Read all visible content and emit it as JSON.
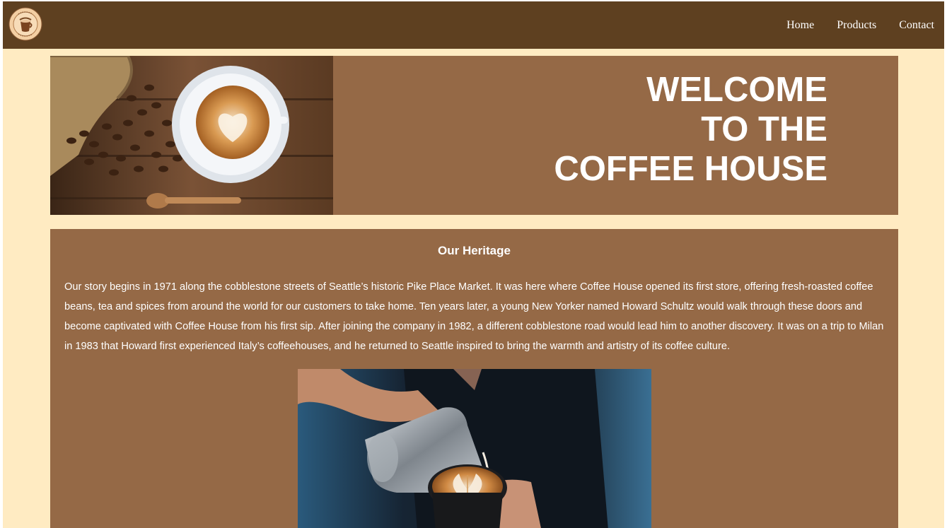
{
  "nav": {
    "logo_text": "coffee beans",
    "links": [
      "Home",
      "Products",
      "Contact"
    ]
  },
  "hero": {
    "title_lines": [
      "WELCOME",
      "TO THE",
      "COFFEE HOUSE"
    ]
  },
  "heritage": {
    "title": "Our Heritage",
    "text": "Our story begins in 1971 along the cobblestone streets of Seattle’s historic Pike Place Market. It was here where Coffee House opened its first store, offering fresh-roasted coffee beans, tea and spices from around the world for our customers to take home. Ten years later, a young New Yorker named Howard Schultz would walk through these doors and become captivated with Coffee House from his first sip. After joining the company in 1982, a different cobblestone road would lead him to another discovery. It was on a trip to Milan in 1983 that Howard first experienced Italy’s coffeehouses, and he returned to Seattle inspired to bring the warmth and artistry of its coffee culture."
  },
  "colors": {
    "navbar": "#5e4020",
    "page_background": "#ffebc2",
    "panel": "#956946",
    "text": "#ffffff"
  }
}
